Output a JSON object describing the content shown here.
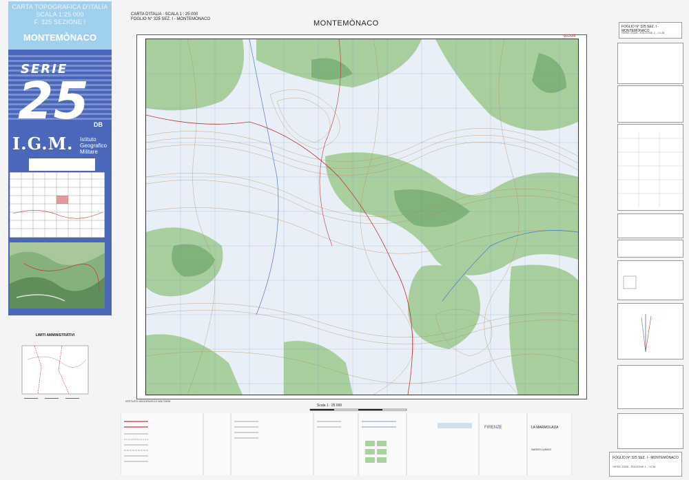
{
  "cover": {
    "line1": "CARTA TOPOGRAFICA D'ITALIA",
    "line2": "SCALA  1:25 000",
    "line3": "F. 325 SEZIONE I",
    "title": "MONTEMÒNACO",
    "serie_word": "SERIE",
    "serie_number": "25",
    "serie_suffix": "DB",
    "igm_letters": "I.G.M.",
    "igm_name_1": "Istituto",
    "igm_name_2": "Geografico",
    "igm_name_3": "Militare",
    "accent": "#4a67b9",
    "sky": "#9fd0ee"
  },
  "admin": {
    "title": "LIMITI AMMINISTRATIVI"
  },
  "sheet": {
    "head_line1": "CARTA D'ITALIA  ·  SCALA  1 : 25 000",
    "head_line2": "FOGLIO N° 325 SEZ. I - MONTEMÒNACO",
    "title": "MONTEMÒNACO",
    "code": "WGS84",
    "publisher": "ISTITUTO GEOGRAFICO MILITARE",
    "scale_text": "Scala  1 : 25 000"
  },
  "right": {
    "top_line1": "FOGLIO N° 325 SEZ. I - MONTEMÒNACO",
    "top_line2": "SERIE 25DB - EDIZIONE 1 - I.G.M.",
    "bottom_line1": "FOGLIO N° 325 SEZ. I - MONTEMÒNACO",
    "bottom_line2": "SERIE 25DB - EDIZIONE 1 - I.G.M."
  },
  "legend": {
    "l1": "FIRENZE",
    "l2": "LA MARMOLADA",
    "l3": "SASSO LUNGO"
  },
  "colors": {
    "forest": "#8cc08a",
    "contour": "#b9875a",
    "grid": "#6a8fd0",
    "frame": "#333333"
  }
}
